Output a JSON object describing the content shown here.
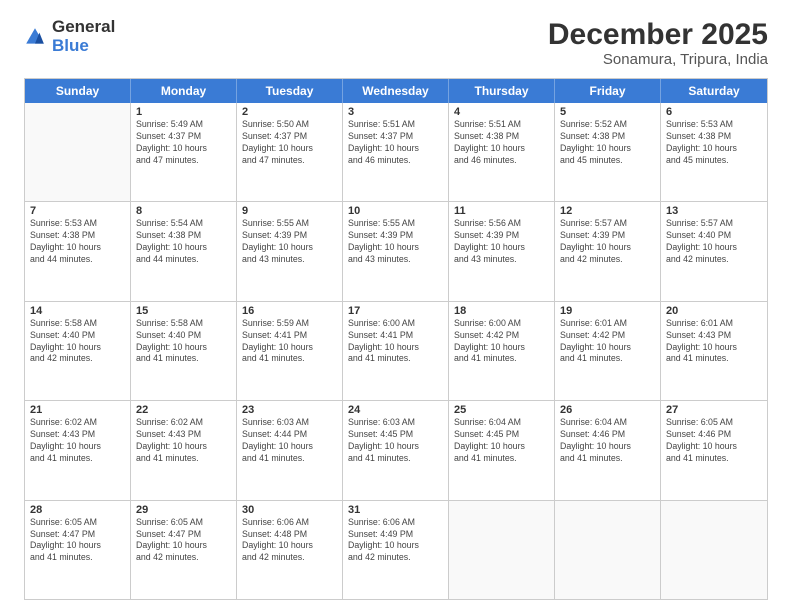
{
  "logo": {
    "general": "General",
    "blue": "Blue"
  },
  "header": {
    "title": "December 2025",
    "location": "Sonamura, Tripura, India"
  },
  "weekdays": [
    "Sunday",
    "Monday",
    "Tuesday",
    "Wednesday",
    "Thursday",
    "Friday",
    "Saturday"
  ],
  "rows": [
    [
      {
        "day": "",
        "info": ""
      },
      {
        "day": "1",
        "info": "Sunrise: 5:49 AM\nSunset: 4:37 PM\nDaylight: 10 hours\nand 47 minutes."
      },
      {
        "day": "2",
        "info": "Sunrise: 5:50 AM\nSunset: 4:37 PM\nDaylight: 10 hours\nand 47 minutes."
      },
      {
        "day": "3",
        "info": "Sunrise: 5:51 AM\nSunset: 4:37 PM\nDaylight: 10 hours\nand 46 minutes."
      },
      {
        "day": "4",
        "info": "Sunrise: 5:51 AM\nSunset: 4:38 PM\nDaylight: 10 hours\nand 46 minutes."
      },
      {
        "day": "5",
        "info": "Sunrise: 5:52 AM\nSunset: 4:38 PM\nDaylight: 10 hours\nand 45 minutes."
      },
      {
        "day": "6",
        "info": "Sunrise: 5:53 AM\nSunset: 4:38 PM\nDaylight: 10 hours\nand 45 minutes."
      }
    ],
    [
      {
        "day": "7",
        "info": "Sunrise: 5:53 AM\nSunset: 4:38 PM\nDaylight: 10 hours\nand 44 minutes."
      },
      {
        "day": "8",
        "info": "Sunrise: 5:54 AM\nSunset: 4:38 PM\nDaylight: 10 hours\nand 44 minutes."
      },
      {
        "day": "9",
        "info": "Sunrise: 5:55 AM\nSunset: 4:39 PM\nDaylight: 10 hours\nand 43 minutes."
      },
      {
        "day": "10",
        "info": "Sunrise: 5:55 AM\nSunset: 4:39 PM\nDaylight: 10 hours\nand 43 minutes."
      },
      {
        "day": "11",
        "info": "Sunrise: 5:56 AM\nSunset: 4:39 PM\nDaylight: 10 hours\nand 43 minutes."
      },
      {
        "day": "12",
        "info": "Sunrise: 5:57 AM\nSunset: 4:39 PM\nDaylight: 10 hours\nand 42 minutes."
      },
      {
        "day": "13",
        "info": "Sunrise: 5:57 AM\nSunset: 4:40 PM\nDaylight: 10 hours\nand 42 minutes."
      }
    ],
    [
      {
        "day": "14",
        "info": "Sunrise: 5:58 AM\nSunset: 4:40 PM\nDaylight: 10 hours\nand 42 minutes."
      },
      {
        "day": "15",
        "info": "Sunrise: 5:58 AM\nSunset: 4:40 PM\nDaylight: 10 hours\nand 41 minutes."
      },
      {
        "day": "16",
        "info": "Sunrise: 5:59 AM\nSunset: 4:41 PM\nDaylight: 10 hours\nand 41 minutes."
      },
      {
        "day": "17",
        "info": "Sunrise: 6:00 AM\nSunset: 4:41 PM\nDaylight: 10 hours\nand 41 minutes."
      },
      {
        "day": "18",
        "info": "Sunrise: 6:00 AM\nSunset: 4:42 PM\nDaylight: 10 hours\nand 41 minutes."
      },
      {
        "day": "19",
        "info": "Sunrise: 6:01 AM\nSunset: 4:42 PM\nDaylight: 10 hours\nand 41 minutes."
      },
      {
        "day": "20",
        "info": "Sunrise: 6:01 AM\nSunset: 4:43 PM\nDaylight: 10 hours\nand 41 minutes."
      }
    ],
    [
      {
        "day": "21",
        "info": "Sunrise: 6:02 AM\nSunset: 4:43 PM\nDaylight: 10 hours\nand 41 minutes."
      },
      {
        "day": "22",
        "info": "Sunrise: 6:02 AM\nSunset: 4:43 PM\nDaylight: 10 hours\nand 41 minutes."
      },
      {
        "day": "23",
        "info": "Sunrise: 6:03 AM\nSunset: 4:44 PM\nDaylight: 10 hours\nand 41 minutes."
      },
      {
        "day": "24",
        "info": "Sunrise: 6:03 AM\nSunset: 4:45 PM\nDaylight: 10 hours\nand 41 minutes."
      },
      {
        "day": "25",
        "info": "Sunrise: 6:04 AM\nSunset: 4:45 PM\nDaylight: 10 hours\nand 41 minutes."
      },
      {
        "day": "26",
        "info": "Sunrise: 6:04 AM\nSunset: 4:46 PM\nDaylight: 10 hours\nand 41 minutes."
      },
      {
        "day": "27",
        "info": "Sunrise: 6:05 AM\nSunset: 4:46 PM\nDaylight: 10 hours\nand 41 minutes."
      }
    ],
    [
      {
        "day": "28",
        "info": "Sunrise: 6:05 AM\nSunset: 4:47 PM\nDaylight: 10 hours\nand 41 minutes."
      },
      {
        "day": "29",
        "info": "Sunrise: 6:05 AM\nSunset: 4:47 PM\nDaylight: 10 hours\nand 42 minutes."
      },
      {
        "day": "30",
        "info": "Sunrise: 6:06 AM\nSunset: 4:48 PM\nDaylight: 10 hours\nand 42 minutes."
      },
      {
        "day": "31",
        "info": "Sunrise: 6:06 AM\nSunset: 4:49 PM\nDaylight: 10 hours\nand 42 minutes."
      },
      {
        "day": "",
        "info": ""
      },
      {
        "day": "",
        "info": ""
      },
      {
        "day": "",
        "info": ""
      }
    ]
  ]
}
